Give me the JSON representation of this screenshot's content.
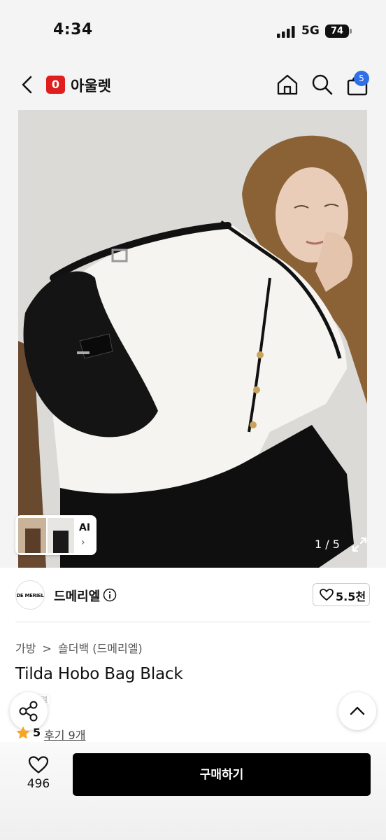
{
  "status_bar": {
    "time": "4:34",
    "network": "5G",
    "battery": "74"
  },
  "header": {
    "logo_badge": "0",
    "title": "아울렛",
    "cart_count": "5"
  },
  "gallery": {
    "ai_label": "AI",
    "counter": "1 / 5"
  },
  "seller": {
    "logo_text": "DE MERIEL",
    "name": "드메리엘",
    "likes": "5.5천"
  },
  "breadcrumb": {
    "category": "가방",
    "separator": ">",
    "subcategory": "숄더백 (드메리엘)"
  },
  "product": {
    "title": "Tilda Hobo Bag Black",
    "tag": "드메리엘"
  },
  "rating": {
    "score": "5",
    "reviews": "후기 9개"
  },
  "bottom_bar": {
    "favorites": "496",
    "buy_label": "구매하기"
  },
  "colors": {
    "brand_red": "#e01e1e",
    "badge_blue": "#2f6fe8",
    "buy_black": "#000000",
    "star": "#f5a623"
  }
}
